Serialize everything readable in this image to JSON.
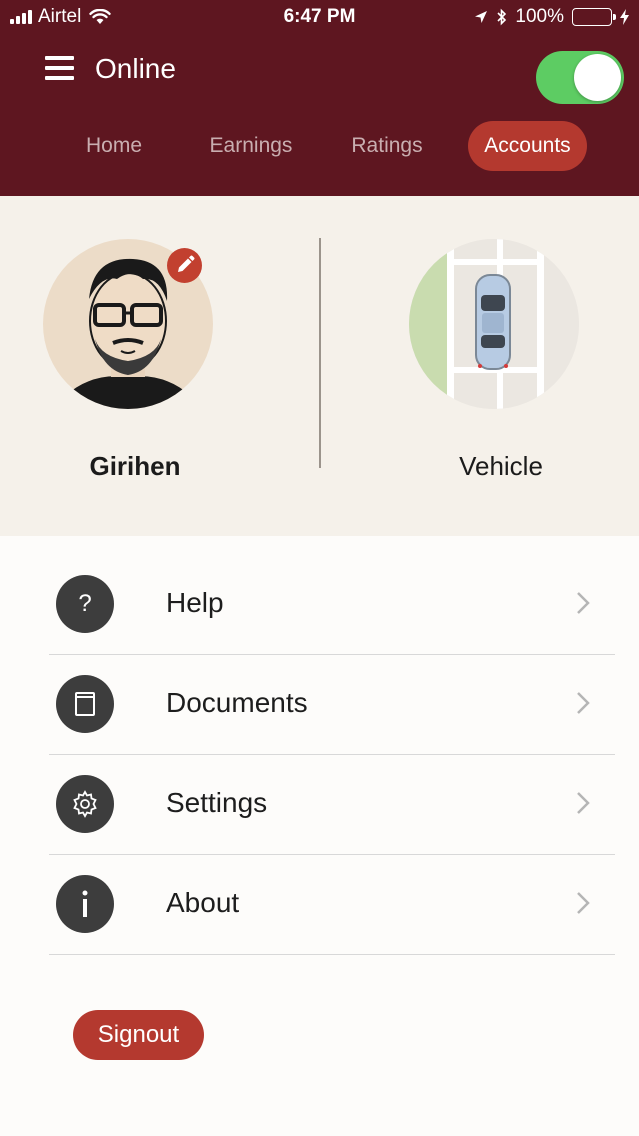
{
  "status_bar": {
    "carrier": "Airtel",
    "time": "6:47 PM",
    "battery_percent": "100%",
    "battery_color": "#4cd964"
  },
  "header": {
    "title": "Online",
    "online_toggle_on": true,
    "menu_icon": "hamburger-icon",
    "background": "#5e1620"
  },
  "tabs": [
    {
      "label": "Home",
      "active": false
    },
    {
      "label": "Earnings",
      "active": false
    },
    {
      "label": "Ratings",
      "active": false
    },
    {
      "label": "Accounts",
      "active": true
    }
  ],
  "profile": {
    "name": "Girihen",
    "vehicle_label": "Vehicle",
    "edit_icon": "pencil-icon"
  },
  "menu": [
    {
      "label": "Help",
      "icon": "question-icon"
    },
    {
      "label": "Documents",
      "icon": "document-icon"
    },
    {
      "label": "Settings",
      "icon": "gear-icon"
    },
    {
      "label": "About",
      "icon": "info-icon"
    }
  ],
  "signout_label": "Signout",
  "accent_color": "#b4392f"
}
